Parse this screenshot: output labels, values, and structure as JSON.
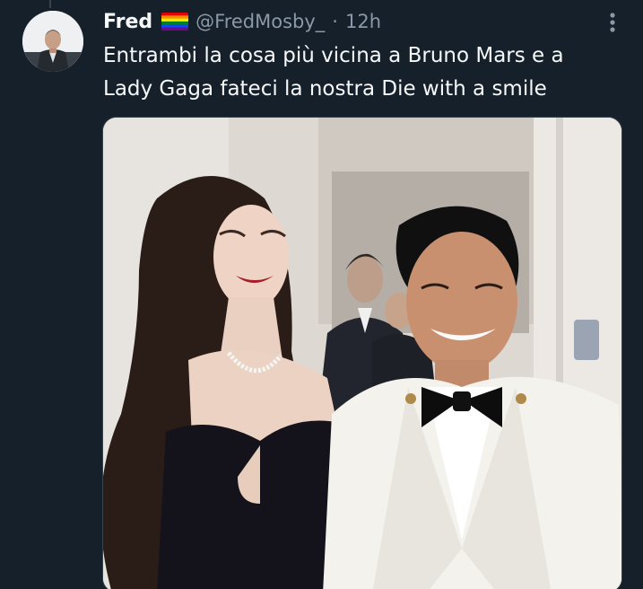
{
  "tweet": {
    "display_name": "Fred",
    "flag_icon": "rainbow-flag-icon",
    "handle": "@FredMosby_",
    "separator": "·",
    "time": "12h",
    "text": "Entrambi la cosa più vicina a Bruno Mars e a\nLady Gaga fateci la nostra Die with a smile",
    "more_icon": "ellipsis-icon"
  },
  "colors": {
    "background": "#15202b",
    "primary_text": "#f7f9f9",
    "secondary_text": "#8b98a5",
    "border": "#38444d"
  }
}
